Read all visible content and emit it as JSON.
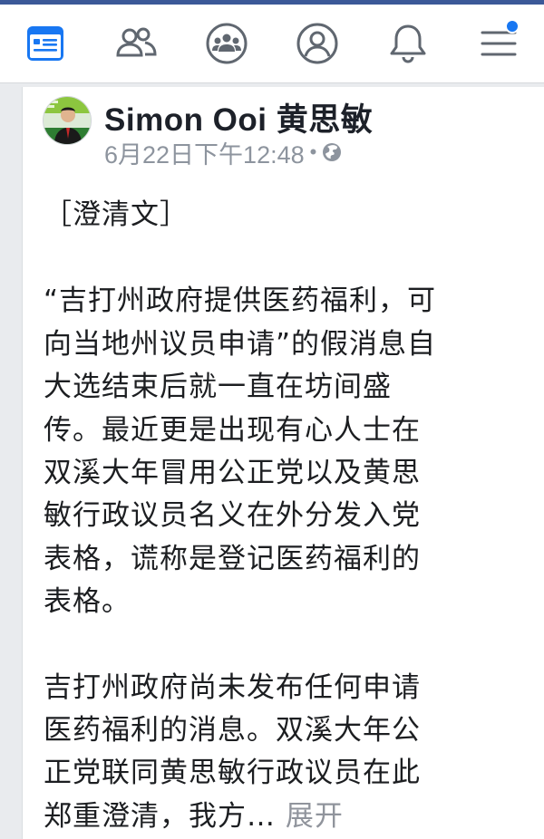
{
  "nav": {
    "items": [
      {
        "name": "news-feed",
        "icon": "news-feed-icon",
        "active": true
      },
      {
        "name": "friends",
        "icon": "friends-icon",
        "active": false
      },
      {
        "name": "groups",
        "icon": "groups-icon",
        "active": false
      },
      {
        "name": "profile",
        "icon": "profile-icon",
        "active": false
      },
      {
        "name": "notifications",
        "icon": "bell-icon",
        "active": false
      },
      {
        "name": "menu",
        "icon": "menu-icon",
        "active": false,
        "badge": true
      }
    ],
    "accent_color": "#1877f2",
    "inactive_color": "#606770"
  },
  "post": {
    "author": "Simon Ooi 黄思敏",
    "timestamp": "6月22日下午12:48",
    "separator": "•",
    "privacy_icon": "globe-icon",
    "paragraph1": "［澄清文］",
    "paragraph2_lines": [
      "“吉打州政府提供医药福利，可",
      "向当地州议员申请”的假消息自",
      "大选结束后就一直在坊间盛",
      "传。最近更是出现有心人士在",
      "双溪大年冒用公正党以及黄思",
      "敏行政议员名义在外分发入党",
      "表格，谎称是登记医药福利的",
      "表格。"
    ],
    "paragraph3_lines": [
      "吉打州政府尚未发布任何申请",
      "医药福利的消息。双溪大年公",
      "正党联同黄思敏行政议员在此"
    ],
    "last_line_text": "郑重澄清，我方…",
    "see_more": "展开"
  }
}
